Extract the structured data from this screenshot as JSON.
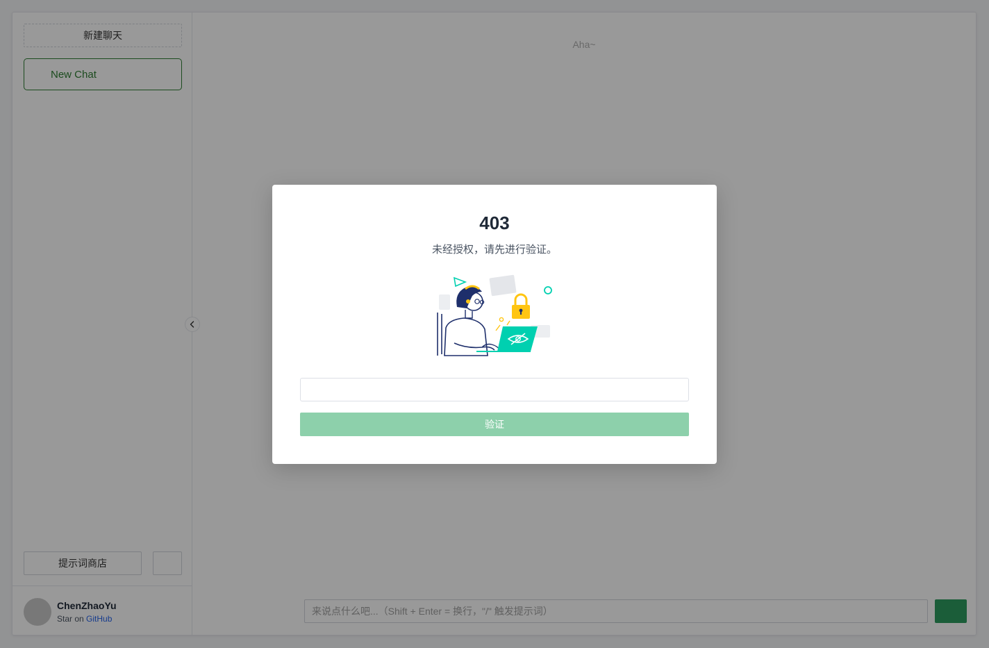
{
  "sidebar": {
    "new_chat_label": "新建聊天",
    "chats": [
      {
        "title": "New Chat",
        "active": true
      }
    ],
    "prompt_store_label": "提示词商店",
    "user": {
      "name": "ChenZhaoYu",
      "star_prefix": "Star on",
      "star_link": "GitHub"
    }
  },
  "main": {
    "welcome_text": "Aha~",
    "input_placeholder": "来说点什么吧...（Shift + Enter = 换行，\"/\" 触发提示词）"
  },
  "modal": {
    "title": "403",
    "description": "未经授权，请先进行验证。",
    "input_value": "",
    "verify_label": "验证"
  },
  "colors": {
    "accent": "#2e7d32",
    "send_button": "#2e9b5f",
    "verify_button_disabled": "#8dd0ab",
    "overlay": "rgba(0,0,0,0.40)",
    "illustration_teal": "#00d0b0",
    "illustration_navy": "#1e2f6b",
    "illustration_yellow": "#ffc512"
  },
  "icons": {
    "collapse": "chevron-left-icon",
    "settings": "gear-icon",
    "send": "send-icon"
  }
}
